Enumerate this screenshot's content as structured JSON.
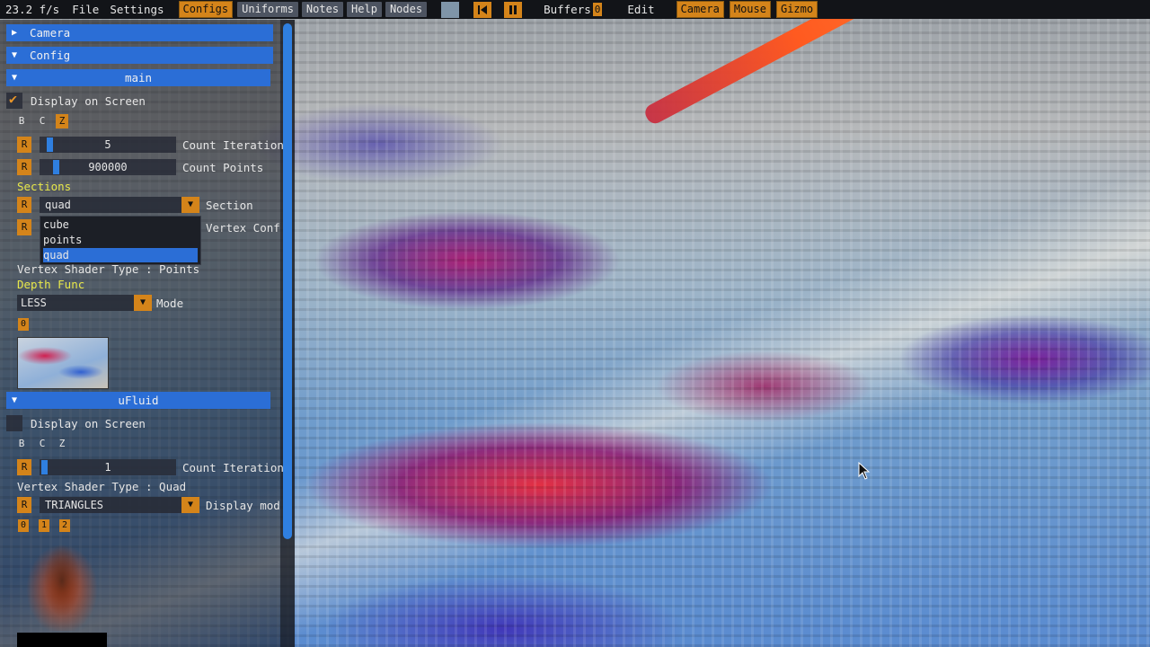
{
  "menubar": {
    "fps": "23.2 f/s",
    "file": "File",
    "settings": "Settings",
    "configs": "Configs",
    "uniforms": "Uniforms",
    "notes": "Notes",
    "help": "Help",
    "nodes": "Nodes",
    "swatch_color": "#7f95a8",
    "buffers": "Buffers",
    "buffers_count": "0",
    "edit": "Edit",
    "camera": "Camera",
    "mouse": "Mouse",
    "gizmo": "Gizmo",
    "icons": [
      "skip-back-icon",
      "pause-icon"
    ]
  },
  "panel": {
    "camera_header": "Camera",
    "config_header": "Config",
    "main": {
      "header": "main",
      "display_on_screen": "Display on Screen",
      "display_checked": true,
      "b": "B",
      "c": "C",
      "z": "Z",
      "r": "R",
      "count_iteration_value": "5",
      "count_iteration_label": "Count Iteration",
      "count_points_value": "900000",
      "count_points_label": "Count Points",
      "sections_title": "Sections",
      "section_value": "quad",
      "section_label": "Section",
      "vertex_conf_label": "Vertex Conf",
      "dropdown_options": [
        "cube",
        "points",
        "quad"
      ],
      "dropdown_selected": "quad",
      "vertex_shader_type": "Vertex Shader Type : Points",
      "depth_func_title": "Depth Func",
      "depth_value": "LESS",
      "mode_label": "Mode",
      "buffer_badge": "0"
    },
    "ufluid": {
      "header": "uFluid",
      "display_on_screen": "Display on Screen",
      "display_checked": false,
      "b": "B",
      "c": "C",
      "z": "Z",
      "r": "R",
      "count_iteration_value": "1",
      "count_iteration_label": "Count Iteration",
      "vertex_shader_type": "Vertex Shader Type : Quad",
      "display_mode_value": "TRIANGLES",
      "display_mode_label": "Display mod",
      "buffer_badges": [
        "0",
        "1",
        "2"
      ]
    }
  },
  "colors": {
    "accent_orange": "#d4841a",
    "header_blue": "#2b6ed6",
    "slider_blue": "#2f7fe0",
    "section_yellow": "#e8e84a"
  }
}
